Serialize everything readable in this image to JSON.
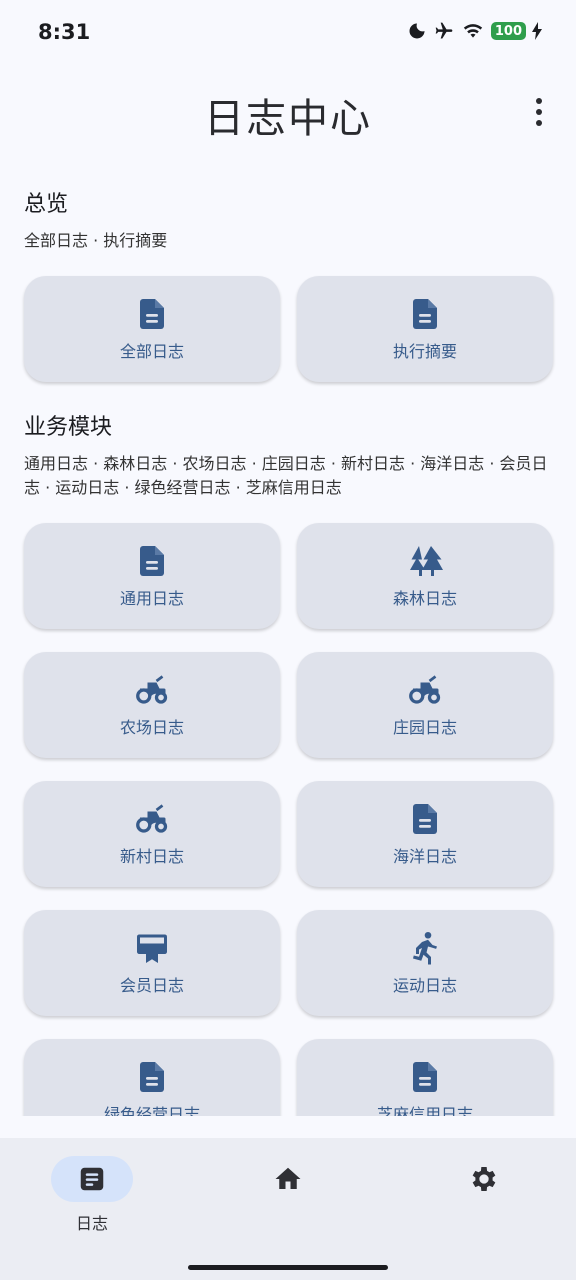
{
  "status": {
    "time": "8:31",
    "battery": "100"
  },
  "app": {
    "title": "日志中心"
  },
  "overview": {
    "title": "总览",
    "subtitle": "全部日志 · 执行摘要",
    "cards": [
      {
        "label": "全部日志",
        "icon": "document-icon"
      },
      {
        "label": "执行摘要",
        "icon": "document-icon"
      }
    ]
  },
  "modules": {
    "title": "业务模块",
    "subtitle": "通用日志 · 森林日志 · 农场日志 · 庄园日志 · 新村日志 · 海洋日志 · 会员日志 · 运动日志 · 绿色经营日志 · 芝麻信用日志",
    "cards": [
      {
        "label": "通用日志",
        "icon": "document-icon"
      },
      {
        "label": "森林日志",
        "icon": "forest-icon"
      },
      {
        "label": "农场日志",
        "icon": "tractor-icon"
      },
      {
        "label": "庄园日志",
        "icon": "tractor-icon"
      },
      {
        "label": "新村日志",
        "icon": "tractor-icon"
      },
      {
        "label": "海洋日志",
        "icon": "document-icon"
      },
      {
        "label": "会员日志",
        "icon": "membership-card-icon"
      },
      {
        "label": "运动日志",
        "icon": "running-person-icon"
      },
      {
        "label": "绿色经营日志",
        "icon": "document-icon"
      },
      {
        "label": "芝麻信用日志",
        "icon": "document-icon"
      }
    ]
  },
  "nav": {
    "items": [
      {
        "label": "日志",
        "icon": "log-icon",
        "active": true
      },
      {
        "label": "",
        "icon": "home-icon"
      },
      {
        "label": "",
        "icon": "settings-gear-icon"
      }
    ]
  },
  "colors": {
    "accent": "#375b8b",
    "card_bg": "#dfe2eb",
    "nav_active": "#d5e3fa"
  }
}
